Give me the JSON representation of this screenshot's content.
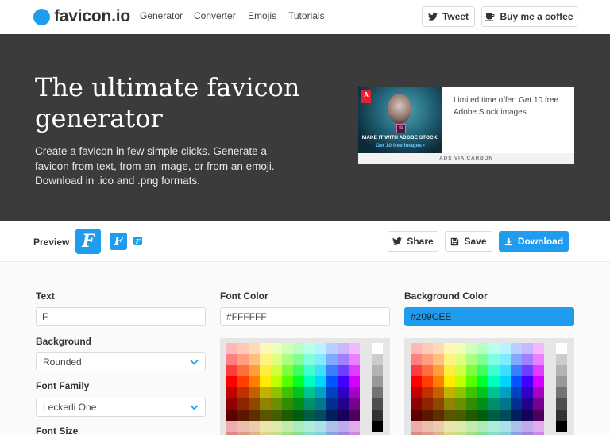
{
  "nav": {
    "logo": "favicon.io",
    "links": [
      "Generator",
      "Converter",
      "Emojis",
      "Tutorials"
    ],
    "tweet": "Tweet",
    "coffee": "Buy me a coffee"
  },
  "hero": {
    "title": "The ultimate favicon generator",
    "subtitle": "Create a favicon in few simple clicks. Generate a favicon from text, from an image, or from an emoji. Download in .ico and .png formats."
  },
  "ad": {
    "logo": "A",
    "badge": "St",
    "headline": "MAKE IT WITH ADOBE STOCK.",
    "cta": "Get 10 free images ›",
    "copy": "Limited time offer: Get 10 free Adobe Stock images.",
    "footer": "ADS VIA CARBON"
  },
  "preview": {
    "label": "Preview",
    "letter": "F",
    "share": "Share",
    "save": "Save",
    "download": "Download"
  },
  "form": {
    "text_label": "Text",
    "text_value": "F",
    "background_label": "Background",
    "background_value": "Rounded",
    "font_family_label": "Font Family",
    "font_family_value": "Leckerli One",
    "font_size_label": "Font Size",
    "font_color_label": "Font Color",
    "font_color_value": "#FFFFFF",
    "bg_color_label": "Background Color",
    "bg_color_value": "#209CEE"
  },
  "colors": {
    "accent": "#209CEE",
    "hero_bg": "#3b3b3b"
  }
}
